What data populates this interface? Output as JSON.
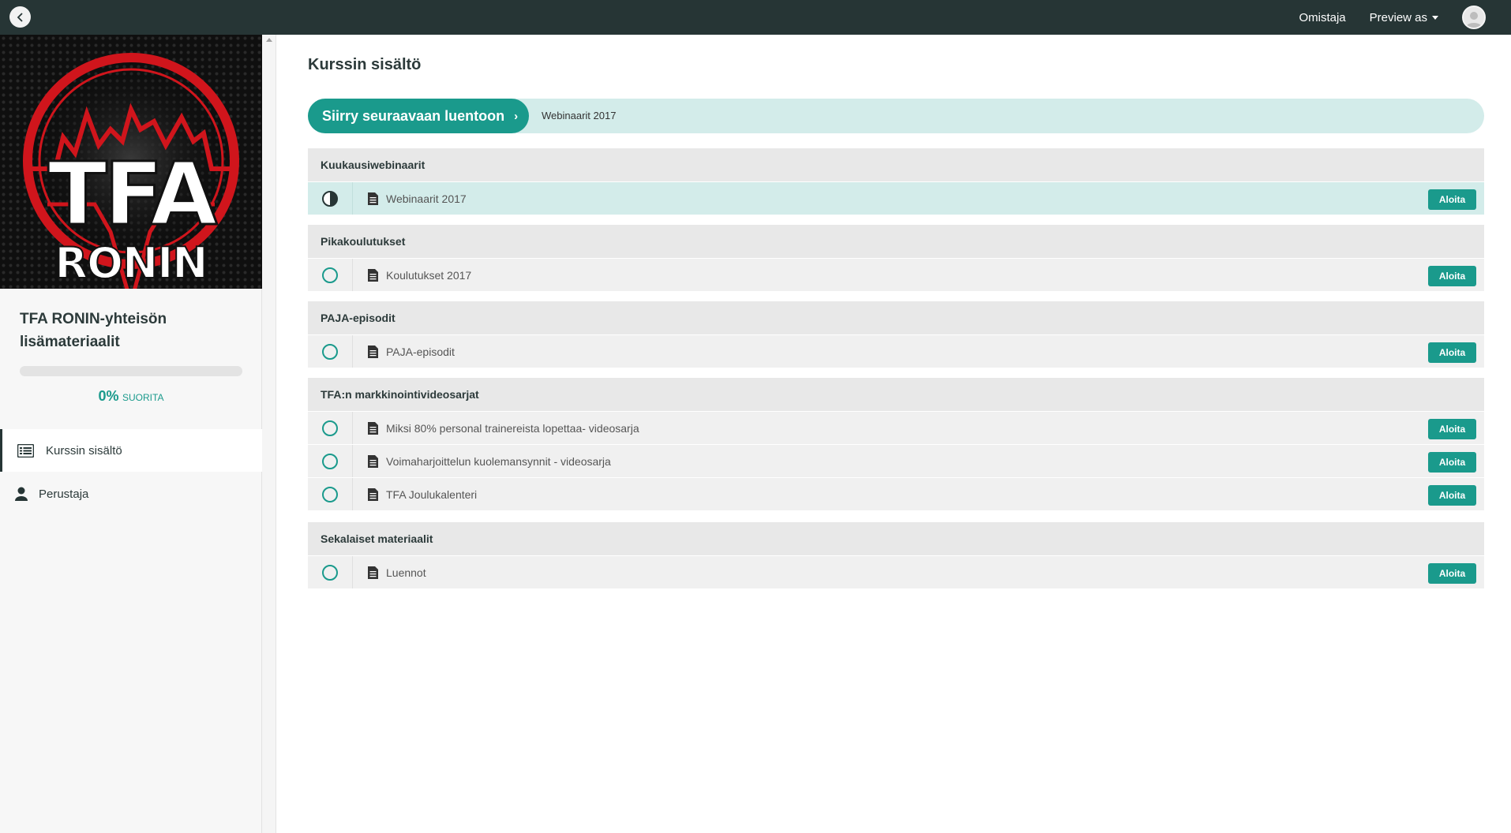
{
  "topbar": {
    "owner_link": "Omistaja",
    "preview_label": "Preview as"
  },
  "sidebar": {
    "course_title": "TFA RONIN-yhteisön lisämateriaalit",
    "logo_text_main": "TFA",
    "logo_text_sub": "RONIN",
    "progress": {
      "percent_value": 0,
      "percent_text": "0%",
      "label": "SUORITA"
    },
    "nav": [
      {
        "label": "Kurssin sisältö",
        "icon": "list-icon",
        "active": true
      },
      {
        "label": "Perustaja",
        "icon": "user-icon",
        "active": false
      }
    ]
  },
  "main": {
    "title": "Kurssin sisältö",
    "next_button_label": "Siirry seuraavaan luentoon",
    "next_lecture_name": "Webinaarit 2017",
    "start_label": "Aloita",
    "sections": [
      {
        "title": "Kuukausiwebinaarit",
        "lectures": [
          {
            "title": "Webinaarit 2017",
            "status": "in-progress"
          }
        ]
      },
      {
        "title": "Pikakoulutukset",
        "lectures": [
          {
            "title": "Koulutukset 2017",
            "status": "not-started"
          }
        ]
      },
      {
        "title": "PAJA-episodit",
        "lectures": [
          {
            "title": "PAJA-episodit",
            "status": "not-started"
          }
        ]
      },
      {
        "title": "TFA:n markkinointivideosarjat",
        "lectures": [
          {
            "title": "Miksi 80% personal trainereista lopettaa- videosarja",
            "status": "not-started"
          },
          {
            "title": "Voimaharjoittelun kuolemansynnit - videosarja",
            "status": "not-started"
          },
          {
            "title": "TFA Joulukalenteri",
            "status": "not-started"
          }
        ]
      },
      {
        "title": "Sekalaiset materiaalit",
        "lectures": [
          {
            "title": "Luennot",
            "status": "not-started"
          }
        ]
      }
    ]
  },
  "colors": {
    "topbar": "#263535",
    "accent": "#1a9a8c",
    "accent_light": "#d3ecea",
    "logo_red": "#d0151c"
  }
}
